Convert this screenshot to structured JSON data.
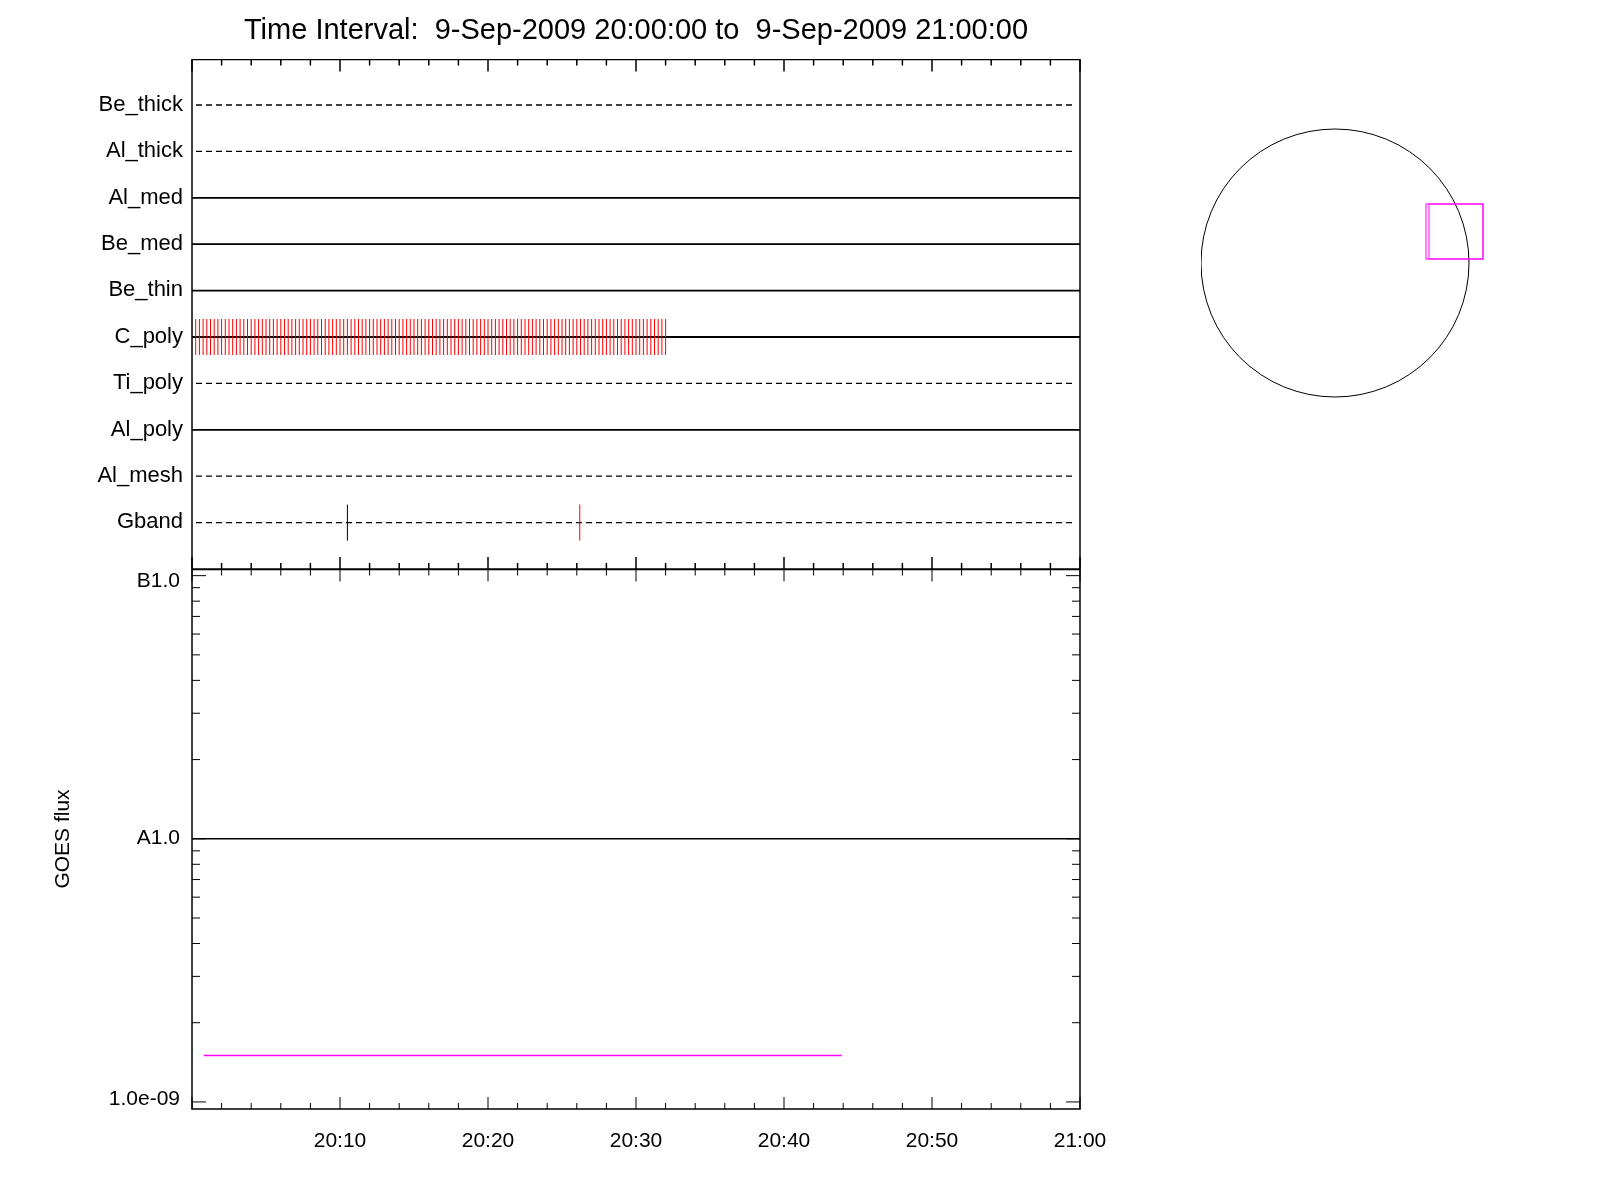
{
  "title": "Time Interval:  9-Sep-2009 20:00:00 to  9-Sep-2009 21:00:00",
  "upper_panel": {
    "channels": [
      {
        "name": "Be_thick",
        "kind": "dashed"
      },
      {
        "name": "Al_thick",
        "kind": "dashed"
      },
      {
        "name": "Al_med",
        "kind": "solid"
      },
      {
        "name": "Be_med",
        "kind": "solid"
      },
      {
        "name": "Be_thin",
        "kind": "solid"
      },
      {
        "name": "C_poly",
        "kind": "solid"
      },
      {
        "name": "Ti_poly",
        "kind": "dashed"
      },
      {
        "name": "Al_poly",
        "kind": "solid"
      },
      {
        "name": "Al_mesh",
        "kind": "dashed"
      },
      {
        "name": "Gband",
        "kind": "dashed"
      }
    ]
  },
  "lower_panel": {
    "y_axis_label": "GOES flux",
    "y_axis_ticks": [
      "B1.0",
      "A1.0",
      "1.0e-09"
    ],
    "x_axis_ticks": [
      "20:10",
      "20:20",
      "20:30",
      "20:40",
      "20:50",
      "21:00"
    ]
  }
}
